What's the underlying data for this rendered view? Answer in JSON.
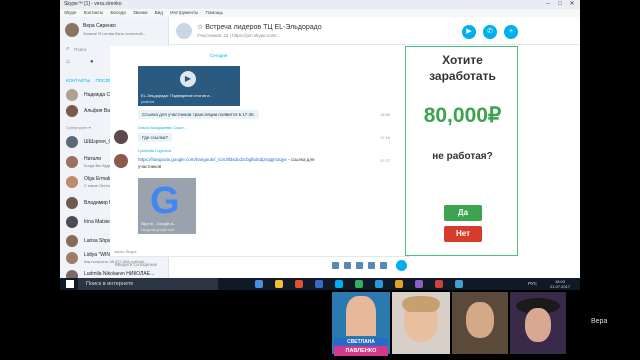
{
  "window": {
    "title": "Skype™ [1] - vera.sirenko"
  },
  "menu": [
    "Skype",
    "Контакты",
    "Беседа",
    "Звонки",
    "Вид",
    "Инструменты",
    "Помощь"
  ],
  "profile": {
    "name": "Вера Сиренко",
    "status": "Занята! Я готова быть полезной..."
  },
  "search": {
    "placeholder": "Поиск"
  },
  "tabs": {
    "contacts": "КОНТАКТЫ",
    "recent": "ПОСЛЕДНИЕ",
    "recent_count": "8"
  },
  "sections": {
    "favorites": "Избранные",
    "group": "Супергрупп ▾"
  },
  "contacts": [
    {
      "name": "Надежда Старовойт",
      "sub": ""
    },
    {
      "name": "Альфия Валиахмедова",
      "sub": ""
    },
    {
      "name": "ШШэргея_Омаров!!!",
      "sub": ""
    },
    {
      "name": "Натали",
      "sub": "Когда Вы будете Двигаете в..."
    },
    {
      "name": "Olga Ermakova",
      "sub": "С наше Летон и белоре!"
    },
    {
      "name": "Владимир Гирич",
      "sub": ""
    },
    {
      "name": "Irina Matsieva",
      "sub": ""
    },
    {
      "name": "Larisa Shpak",
      "sub": ""
    },
    {
      "name": "Lidiya \"WINNERS\" Kolpakova",
      "sub": "Как получить 38.237.608 рублей..."
    },
    {
      "name": "Ludmila Nikolaevn НИКОЛАЕ...",
      "sub": ""
    }
  ],
  "conversation": {
    "title": "Встреча лидеров ТЦ EL-Эльдорадо",
    "subtitle": "Участников: 23 | https://join.skype.com/..."
  },
  "chat": {
    "date_label": "Сегодня",
    "media_caption": "EL-Эльдорадо: Подведение итогов и...",
    "media_domain": "youtu.be",
    "msg1": "Ссылка для участников трансляции появится в 17.30.",
    "msg1_time": "16:56",
    "sender2": "Ольга Болдырева: Ссыл...",
    "msg2": "Где ссылка?",
    "msg2_time": "17:16",
    "sender3": "Lyudmila Loginova",
    "link3": "https://hangouts.google.com/hangouts/_/cm3ll3sdcdzcbglbdsdj2rqqjm3qye",
    "link3_tail": " - ссылка для",
    "link3_cont": "участников",
    "msg3_time": "17:27",
    "card_caption": "Sign in - Google A...",
    "card_domain": "hangouts.google.com",
    "via": "через Skype",
    "input_placeholder": "Введите сообщение"
  },
  "ad": {
    "line1": "Хотите",
    "line2": "заработать",
    "money": "80,000₽",
    "line3": "не работая?",
    "yes": "Да",
    "no": "Нет"
  },
  "taskbar": {
    "search_placeholder": "Поиск в интернете",
    "lang": "РУС",
    "time": "18:03",
    "date": "21.07.2017"
  },
  "video": {
    "badge_line1": "СВЕТЛАНА",
    "badge_line2": "ПАВЛЕНКО",
    "caller": "Вера"
  },
  "colors": {
    "accent": "#00aff0",
    "ad_green": "#3ca34f",
    "ad_red": "#d63c2c"
  }
}
